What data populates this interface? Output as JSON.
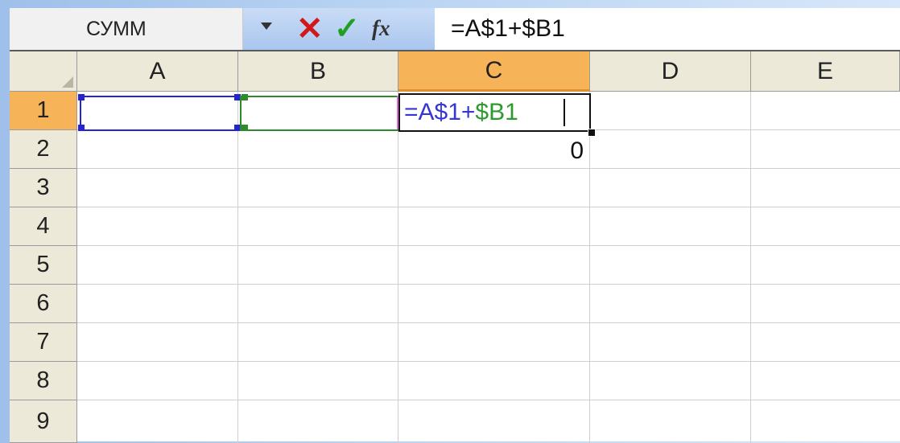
{
  "formula_bar": {
    "name_box": "СУММ",
    "cancel_glyph": "✕",
    "enter_glyph": "✓",
    "fx_glyph": "fx",
    "formula": "=A$1+$B1"
  },
  "columns": [
    "A",
    "B",
    "C",
    "D",
    "E"
  ],
  "rows": [
    "1",
    "2",
    "3",
    "4",
    "5",
    "6",
    "7",
    "8",
    "9"
  ],
  "active_column": "C",
  "active_row": "1",
  "edit_cell": {
    "part1": "=A$1+",
    "part2": "$B1",
    "part1_color": "#3535d8",
    "part2_color": "#2d9a2d"
  },
  "cells": {
    "C2": "0"
  },
  "colors": {
    "header_bg": "#ece9d8",
    "active_header_bg": "#f7b357",
    "ref_a_border": "#2424d0",
    "ref_b_border": "#2d8a2d"
  }
}
